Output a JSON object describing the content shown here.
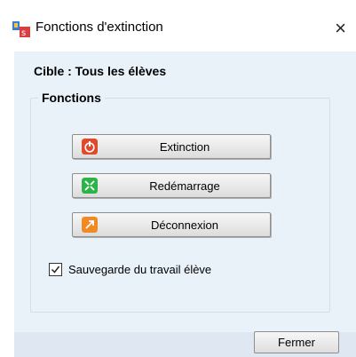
{
  "window": {
    "title": "Fonctions d'extinction",
    "close_glyph": "×"
  },
  "target": {
    "text": "Cible :  Tous les élèves"
  },
  "group": {
    "legend": "Fonctions"
  },
  "functions": [
    {
      "label": "Extinction",
      "icon": "power-icon",
      "color": "#e04a2a"
    },
    {
      "label": "Redémarrage",
      "icon": "restart-icon",
      "color": "#2db34a"
    },
    {
      "label": "Déconnexion",
      "icon": "logout-icon",
      "color": "#f08a24"
    }
  ],
  "save_work": {
    "label": "Sauvegarde du travail élève",
    "checked": true
  },
  "footer": {
    "close_label": "Fermer"
  }
}
